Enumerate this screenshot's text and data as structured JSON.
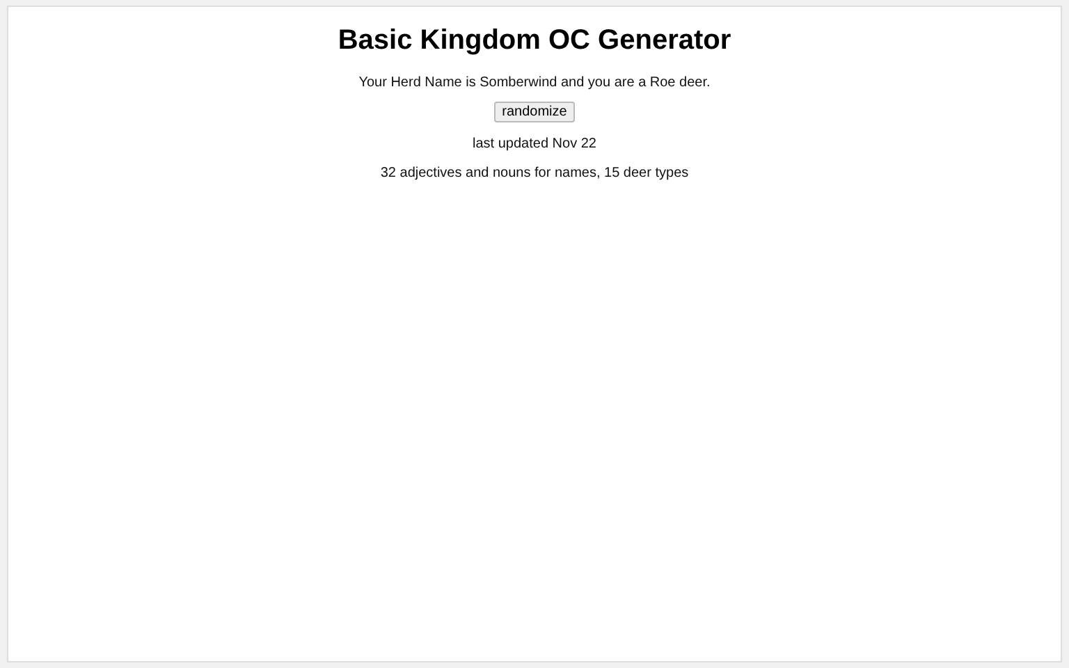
{
  "title": "Basic Kingdom OC Generator",
  "result": "Your Herd Name is Somberwind and you are a Roe deer.",
  "button": "randomize",
  "updated": "last updated Nov 22",
  "stats": "32 adjectives and nouns for names, 15 deer types"
}
